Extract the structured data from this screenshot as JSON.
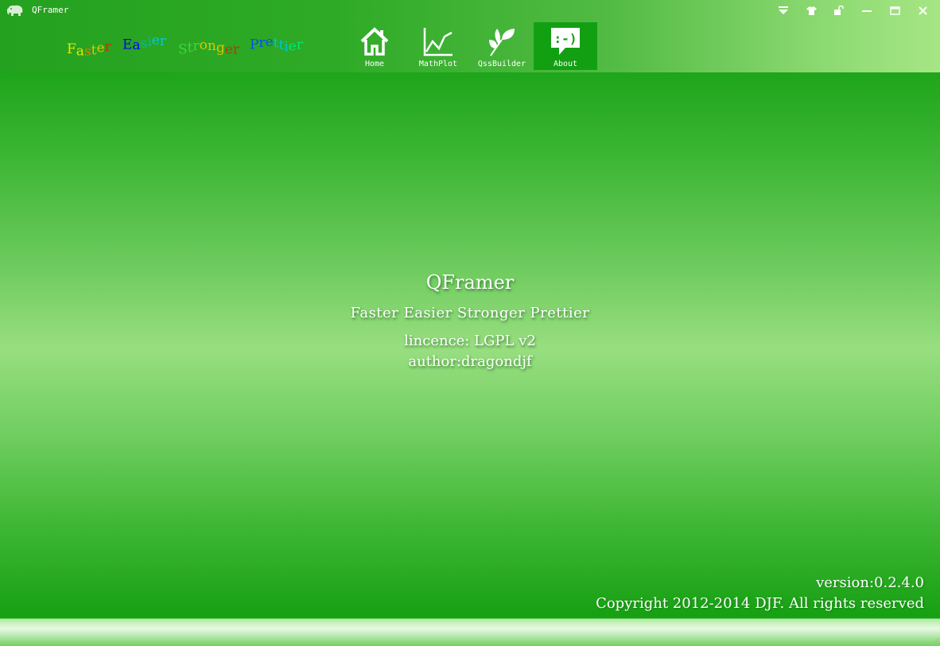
{
  "window": {
    "title": "QFramer",
    "app_icon": "elephant-icon",
    "controls": [
      {
        "name": "dropdown-menu-button",
        "icon": "triangle-down-icon"
      },
      {
        "name": "skin-button",
        "icon": "tshirt-icon"
      },
      {
        "name": "lock-button",
        "icon": "unlock-icon"
      },
      {
        "name": "minimize-button",
        "icon": "minimize-icon"
      },
      {
        "name": "maximize-button",
        "icon": "maximize-icon"
      },
      {
        "name": "close-button",
        "icon": "close-icon"
      }
    ]
  },
  "header": {
    "slogan_words": [
      {
        "text": "Faster",
        "colors": [
          "#e8e800",
          "#ff6a00",
          "#d8c800",
          "#c83200"
        ]
      },
      {
        "text": "Easier",
        "colors": [
          "#0000ff",
          "#00b8b8",
          "#00c8e8"
        ]
      },
      {
        "text": "Stronger",
        "colors": [
          "#3cd83c",
          "#d8c800",
          "#c83200"
        ]
      },
      {
        "text": "Prettier",
        "colors": [
          "#0050ff",
          "#00c8c8",
          "#00e870"
        ]
      }
    ]
  },
  "nav": {
    "active": "About",
    "items": [
      {
        "label": "Home",
        "icon": "home-icon"
      },
      {
        "label": "MathPlot",
        "icon": "line-chart-icon"
      },
      {
        "label": "QssBuilder",
        "icon": "leaf-icon"
      },
      {
        "label": "About",
        "icon": "smiley-speech-bubble-icon"
      }
    ]
  },
  "about": {
    "title": "QFramer",
    "slogan": "Faster Easier Stronger Prettier",
    "licence": "lincence: LGPL v2",
    "author": "author:dragondjf"
  },
  "footer": {
    "version": "version:0.2.4.0",
    "copyright": "Copyright 2012-2014 DJF. All rights reserved"
  },
  "colors": {
    "primary_green": "#12a012",
    "light_green": "#98de80",
    "text": "#ffffff"
  }
}
